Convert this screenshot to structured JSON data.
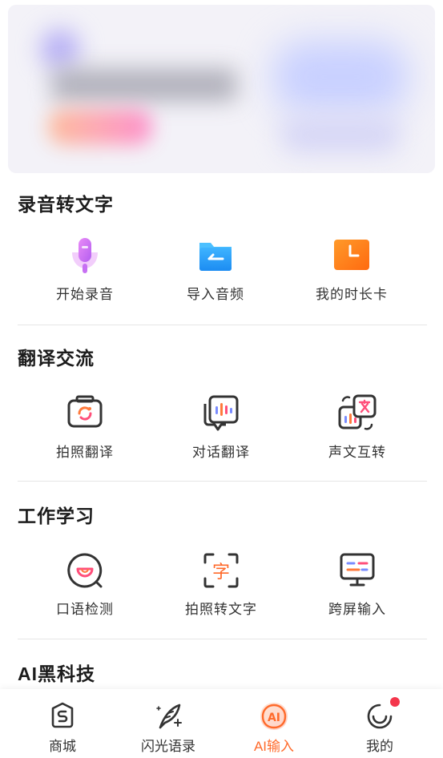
{
  "sections": [
    {
      "title": "录音转文字",
      "items": [
        {
          "label": "开始录音",
          "icon": "microphone-icon"
        },
        {
          "label": "导入音频",
          "icon": "folder-import-icon"
        },
        {
          "label": "我的时长卡",
          "icon": "time-card-icon"
        }
      ]
    },
    {
      "title": "翻译交流",
      "items": [
        {
          "label": "拍照翻译",
          "icon": "camera-translate-icon"
        },
        {
          "label": "对话翻译",
          "icon": "dialog-translate-icon"
        },
        {
          "label": "声文互转",
          "icon": "voice-text-convert-icon"
        }
      ]
    },
    {
      "title": "工作学习",
      "items": [
        {
          "label": "口语检测",
          "icon": "speaking-test-icon"
        },
        {
          "label": "拍照转文字",
          "icon": "photo-to-text-icon"
        },
        {
          "label": "跨屏输入",
          "icon": "cross-screen-icon"
        }
      ]
    },
    {
      "title": "AI黑科技",
      "items": []
    }
  ],
  "nav": {
    "items": [
      {
        "label": "商城",
        "icon": "shop-bag-icon"
      },
      {
        "label": "闪光语录",
        "icon": "feather-sparkle-icon"
      },
      {
        "label": "AI输入",
        "icon": "ai-input-icon",
        "active": true
      },
      {
        "label": "我的",
        "icon": "smiley-profile-icon",
        "badge": true
      }
    ]
  },
  "colors": {
    "accent": "#ff6a2b",
    "badge": "#f4364c"
  }
}
